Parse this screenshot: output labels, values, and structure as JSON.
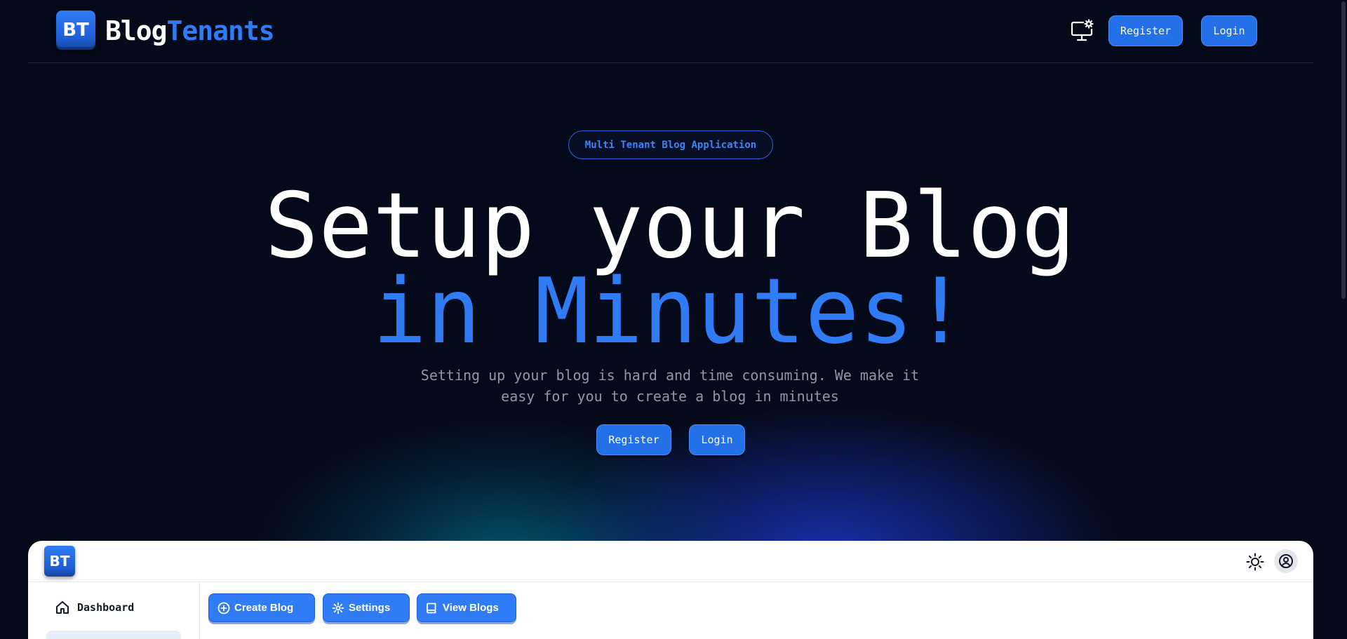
{
  "brand": {
    "logo_text": "BT",
    "name_part1": "Blog",
    "name_part2": "Tenants"
  },
  "header": {
    "register_label": "Register",
    "login_label": "Login",
    "settings_icon": "monitor-settings-icon"
  },
  "hero": {
    "badge": "Multi Tenant Blog Application",
    "title_line1": "Setup your Blog",
    "title_line2": "in Minutes!",
    "subtitle": "Setting up your blog is hard and time consuming. We make it easy for you to create a blog in minutes",
    "register_label": "Register",
    "login_label": "Login"
  },
  "preview": {
    "logo_text": "BT",
    "nav": {
      "dashboard_label": "Dashboard"
    },
    "actions": {
      "create_label": "Create Blog",
      "settings_label": "Settings",
      "view_label": "View Blogs"
    },
    "icons": {
      "theme": "sun-icon",
      "user": "user-circle-icon"
    }
  },
  "colors": {
    "background": "#050a1a",
    "accent": "#2f7cf6",
    "button": "#2470e8",
    "muted_text": "#8e97a8"
  }
}
